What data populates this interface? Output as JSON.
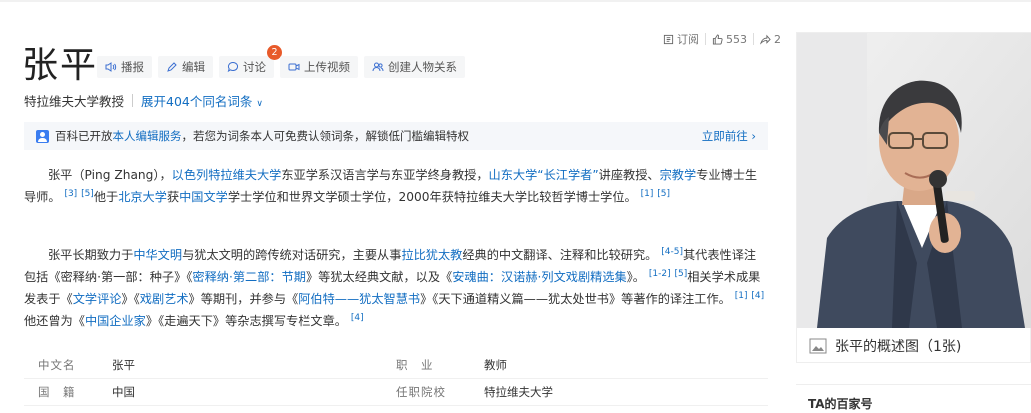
{
  "title": "张平",
  "actions": [
    {
      "label": "播报",
      "icon": "speaker-icon"
    },
    {
      "label": "编辑",
      "icon": "pencil-icon"
    },
    {
      "label": "讨论",
      "icon": "chat-bubble-icon",
      "badge": "2"
    },
    {
      "label": "上传视频",
      "icon": "video-icon"
    },
    {
      "label": "创建人物关系",
      "icon": "people-icon"
    }
  ],
  "stats": {
    "subscribe_label": "订阅",
    "like_count": "553",
    "share_count": "2"
  },
  "subtitle": {
    "role": "特拉维夫大学教授",
    "expand_label": "展开404个同名词条"
  },
  "notice": {
    "prefix": "百科已开放",
    "service_link": "本人编辑服务",
    "suffix": "，若您为词条本人可免费认领词条，解锁低门槛编辑特权",
    "go_label": "立即前往"
  },
  "para1": {
    "t1": "张平（Ping Zhang），",
    "l1": "以色列特拉维夫大学",
    "t2": "东亚学系汉语言学与东亚学终身教授，",
    "l2": "山东大学",
    "l3": "“长江学者”",
    "t3": "讲座教授、",
    "l4": "宗教学",
    "t4": "专业博士生导师。",
    "r1": "[3]",
    "r2": "[5]",
    "t5": "他于",
    "l5": "北京大学",
    "t6": "获",
    "l6": "中国文学",
    "t7": "学士学位和世界文学硕士学位，2000年获特拉维夫大学比较哲学博士学位。",
    "r3": "[1]",
    "r4": "[5]"
  },
  "para2": {
    "t1": "张平长期致力于",
    "l1": "中华文明",
    "t2": "与犹太文明的跨传统对话研究，主要从事",
    "l2": "拉比犹太教",
    "t3": "经典的中文翻译、注释和比较研究。",
    "r1": "[4-5]",
    "t4": "其代表性译注包括《密释纳·第一部：种子》《",
    "l3": "密释纳·第二部：节期",
    "t5": "》等犹太经典文献，以及《",
    "l4": "安魂曲：汉诺赫·列文戏剧精选集",
    "t6": "》。",
    "r2": "[1-2]",
    "r3": "[5]",
    "t7": "相关学术成果发表于《",
    "l5": "文学评论",
    "t8": "》《",
    "l6": "戏剧艺术",
    "t9": "》等期刊，并参与《",
    "l7": "阿伯特——犹太智慧书",
    "t10": "》《天下通道精义篇——犹太处世书》等著作的译注工作。",
    "r4": "[1]",
    "r5": "[4]",
    "t11": "他还曾为《",
    "l8": "中国企业家",
    "t12": "》《走遍天下》等杂志撰写专栏文章。",
    "r6": "[4]"
  },
  "infobox": [
    {
      "k1": "中文名",
      "v1": "张平",
      "k2": "职　业",
      "v2": "教师"
    },
    {
      "k1": "国　籍",
      "v1": "中国",
      "k2": "任职院校",
      "v2": "特拉维夫大学"
    }
  ],
  "photo": {
    "caption": "张平的概述图（1张)"
  },
  "baijia": {
    "title": "TA的百家号"
  },
  "colors": {
    "link": "#136ec2",
    "badge": "#e85a2a",
    "notice_bg": "#f5f7fa"
  }
}
